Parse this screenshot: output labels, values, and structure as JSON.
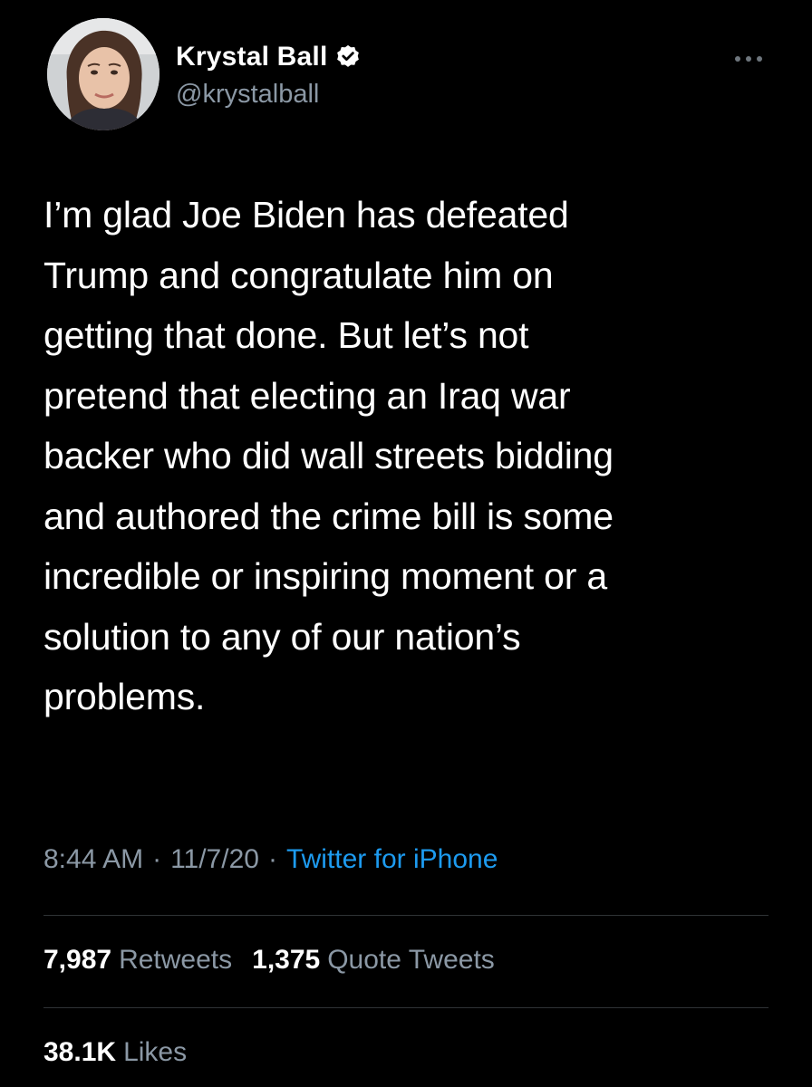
{
  "author": {
    "display_name": "Krystal Ball",
    "handle": "@krystalball",
    "verified": true,
    "avatar_icon": "profile-photo",
    "verified_icon": "verified-badge-icon",
    "more_icon": "more-options-icon"
  },
  "tweet": {
    "text": "I’m glad Joe Biden has defeated\nTrump and congratulate him on\ngetting that done. But let’s not\npretend that electing an Iraq war\nbacker who did wall streets bidding\nand authored the crime bill is some\nincredible or inspiring moment or a\nsolution to any of our nation’s\nproblems."
  },
  "meta": {
    "time": "8:44 AM",
    "separator": "·",
    "date": "11/7/20",
    "source": "Twitter for iPhone"
  },
  "stats": {
    "retweets_count": "7,987",
    "retweets_label": "Retweets",
    "quotes_count": "1,375",
    "quotes_label": "Quote Tweets",
    "likes_count": "38.1K",
    "likes_label": "Likes"
  },
  "colors": {
    "background": "#000000",
    "text_primary": "#ffffff",
    "text_secondary": "#8b98a5",
    "link": "#1d9bf0",
    "divider": "#2f3336"
  }
}
